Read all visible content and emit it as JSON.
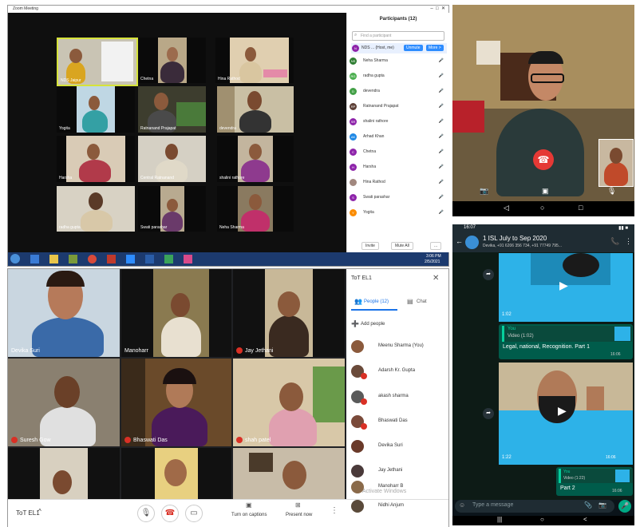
{
  "zoom": {
    "window_title": "Zoom Meeting",
    "participants_title": "Participants (12)",
    "search_placeholder": "Find a participant",
    "host_name": "NDS ... (Host, me)",
    "unmute_label": "Unmute",
    "more_label": "More >",
    "invite_label": "Invite",
    "mute_all_label": "Mute All",
    "more_dots": "...",
    "tiles": [
      {
        "name": "NDS   Jaipur"
      },
      {
        "name": "Chetna"
      },
      {
        "name": "Hina Rathod"
      },
      {
        "name": "Yogita"
      },
      {
        "name": "Ratnanand Prajapat"
      },
      {
        "name": "devendra"
      },
      {
        "name": "Harsha"
      },
      {
        "name": "Central Ratnanand"
      },
      {
        "name": "shalini rathore"
      },
      {
        "name": "radha gupta"
      },
      {
        "name": "Swati parashar"
      },
      {
        "name": "Neha Sharma"
      }
    ],
    "participants": [
      {
        "initials": "NS",
        "name": "Neha Sharma",
        "color": "#2e7d32"
      },
      {
        "initials": "RG",
        "name": "radha gupta",
        "color": "#4caf50"
      },
      {
        "initials": "D",
        "name": "devendra",
        "color": "#43a047"
      },
      {
        "initials": "RP",
        "name": "Ratnanand Prajapat",
        "color": "#5d4037"
      },
      {
        "initials": "SR",
        "name": "shalini rathore",
        "color": "#8e24aa"
      },
      {
        "initials": "AK",
        "name": "Arhad Khan",
        "color": "#1e88e5"
      },
      {
        "initials": "C",
        "name": "Chetna",
        "color": "#8e24aa"
      },
      {
        "initials": "H",
        "name": "Harsha",
        "color": "#8e24aa"
      },
      {
        "initials": "",
        "name": "Hina Rathod",
        "color": "#a1887f"
      },
      {
        "initials": "S",
        "name": "Swati parashar",
        "color": "#8e24aa"
      },
      {
        "initials": "Y",
        "name": "Yogita",
        "color": "#fb8c00"
      }
    ],
    "taskbar_time": "3:06 PM",
    "taskbar_date": "2/5/2021"
  },
  "meet": {
    "panel_title": "ToT EL1",
    "people_tab": "People (12)",
    "chat_tab": "Chat",
    "add_people": "Add people",
    "meeting_name": "ToT EL1",
    "turn_on_captions": "Turn on captions",
    "present_now": "Present now",
    "tiles": [
      {
        "name": "Devika Suri"
      },
      {
        "name": "Manoharr"
      },
      {
        "name": "Jay Jethani"
      },
      {
        "name": "Suresh Gow"
      },
      {
        "name": "Bhaswati Das"
      },
      {
        "name": "shah patel"
      },
      {
        "name": ""
      },
      {
        "name": ""
      },
      {
        "name": ""
      }
    ],
    "people": [
      {
        "name": "Meenu Sharma (You)"
      },
      {
        "name": "Adarsh Kr. Gupta"
      },
      {
        "name": "akash sharma"
      },
      {
        "name": "Bhaswati Das"
      },
      {
        "name": "Devika Suri"
      },
      {
        "name": "Jay Jethani"
      },
      {
        "name": "Manoharr B"
      },
      {
        "name": "Nidhi Anjum"
      }
    ],
    "watermark": "Activate Windows"
  },
  "whatsapp": {
    "status_time": "16:07",
    "group_name": "1 ISL July to Sep 2020",
    "members": "Devika, +91 6206 356 734, +91 77749 795...",
    "video1_duration": "1:02",
    "reply_sender": "You",
    "reply_video": "Video (1:02)",
    "reply_text": "Legal, national, Recognition. Part 1",
    "reply_time": "16:06",
    "video2_duration": "1:22",
    "video2_time": "16:06",
    "reply2_sender": "You",
    "reply2_video": "Video (1:22)",
    "reply2_text": "Part 2",
    "reply2_time": "16:06",
    "input_placeholder": "Type a message"
  }
}
